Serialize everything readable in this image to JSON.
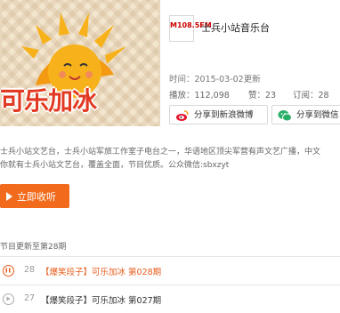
{
  "cover": {
    "logo_text": "可乐加冰",
    "colors": {
      "sun": "#f7b21b",
      "text": "#e23a22",
      "background": "#f3e6cf"
    }
  },
  "station": {
    "logo_text": "M108.5FM",
    "title": "士兵小站音乐台"
  },
  "meta": {
    "time": "时间：2015-03-02更新",
    "plays": "播放：112,098",
    "likes": "赞：23",
    "subscribes": "订阅：28"
  },
  "share": {
    "weibo": {
      "label": "分享到新浪微博",
      "icon": "weibo-icon"
    },
    "wechat": {
      "label": "分享到微信",
      "icon": "wechat-icon"
    }
  },
  "description": {
    "line1": "士兵小站文艺台，士兵小站军旅工作室子电台之一，华语地区顶尖军营有声文艺广播，中文",
    "line2": "你就有士兵小站文艺台，覆盖全面，节目优质。公众微信:sbxzyt"
  },
  "listen_button": {
    "label": "立即收听",
    "color": "#f26b1d"
  },
  "update_note": "节目更新至第28期",
  "episodes": [
    {
      "num": "28",
      "tag": "【爆笑段子】",
      "title": "可乐加冰 第028期",
      "tag_color": "#e85d1c",
      "playing": true
    },
    {
      "num": "27",
      "tag": "【爆笑段子】",
      "title": "可乐加冰 第027期",
      "tag_color": "#333333",
      "playing": false
    }
  ]
}
